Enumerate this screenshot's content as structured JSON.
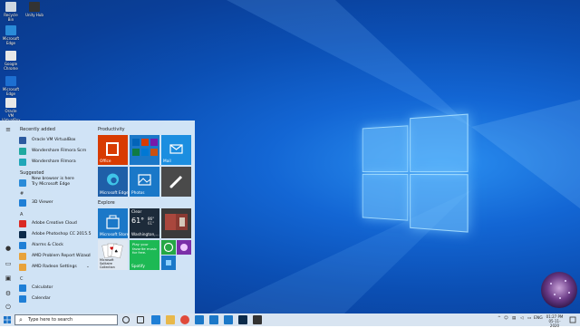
{
  "desktop_icons": [
    {
      "label": "Recycle Bin",
      "color": "#cfd8e2"
    },
    {
      "label": "Microsoft Edge",
      "color": "#2a8bd8"
    },
    {
      "label": "Google Chrome",
      "color": "#e8e8e8"
    },
    {
      "label": "Microsoft Edge",
      "color": "#1d6fd1"
    },
    {
      "label": "Oracle VM VirtualBox",
      "color": "#e8e8e8"
    },
    {
      "label": "Unity Hub",
      "color": "#333333"
    }
  ],
  "start_menu": {
    "recently_added_header": "Recently added",
    "recent": [
      {
        "label": "Oracle VM VirtualBox",
        "icon": "virtualbox-icon",
        "color": "#2c5aa0"
      },
      {
        "label": "Wondershare Filmora Scrn",
        "icon": "filmora-scrn-icon",
        "color": "#1fa9a0"
      },
      {
        "label": "Wondershare Filmora",
        "icon": "filmora-icon",
        "color": "#20a7b8"
      }
    ],
    "suggested_header": "Suggested",
    "suggested": {
      "line1": "New browser is here",
      "line2": "Try Microsoft Edge",
      "icon": "edge-icon",
      "color": "#2a8bd8"
    },
    "groups": [
      {
        "letter": "#",
        "items": [
          {
            "label": "3D Viewer",
            "icon": "3d-viewer-icon",
            "color": "#1f7fd6",
            "chevron": false
          }
        ]
      },
      {
        "letter": "A",
        "items": [
          {
            "label": "Adobe Creative Cloud",
            "icon": "creative-cloud-icon",
            "color": "#da2a24",
            "chevron": false
          },
          {
            "label": "Adobe Photoshop CC 2015.5",
            "icon": "photoshop-icon",
            "color": "#0b2a4a",
            "chevron": false
          },
          {
            "label": "Alarms & Clock",
            "icon": "alarm-clock-icon",
            "color": "#1f7fd6",
            "chevron": false
          },
          {
            "label": "AMD Problem Report Wizard",
            "icon": "amd-icon",
            "color": "#e8a23a",
            "chevron": true
          },
          {
            "label": "AMD Radeon Settings",
            "icon": "amd-radeon-icon",
            "color": "#e8a23a",
            "chevron": true
          }
        ]
      },
      {
        "letter": "C",
        "items": [
          {
            "label": "Calculator",
            "icon": "calculator-icon",
            "color": "#1f7fd6",
            "chevron": false
          },
          {
            "label": "Calendar",
            "icon": "calendar-icon",
            "color": "#1f7fd6",
            "chevron": false
          }
        ]
      }
    ],
    "productivity_header": "Productivity",
    "explore_header": "Explore",
    "tiles": {
      "office": {
        "label": "Office",
        "color": "#d83b01"
      },
      "mini_apps": {
        "color": "#1b78c8",
        "apps": [
          "#0364b8",
          "#d83b01",
          "#7719aa",
          "#0f7b45",
          "#0078d4",
          "#ca5010"
        ]
      },
      "mail": {
        "label": "Mail",
        "color": "#1b8ee0"
      },
      "edge": {
        "label": "Microsoft Edge",
        "color": "#1f5fa8"
      },
      "photos": {
        "label": "Photos",
        "color": "#1a78c8"
      },
      "pen": {
        "color": "#4a4a4a"
      },
      "store": {
        "label": "Microsoft Store",
        "color": "#1b78c8"
      },
      "weather": {
        "label": "Clear",
        "temp": "61°",
        "high": "86°",
        "low": "61°",
        "city": "Washington,...",
        "color": "#1d2b3a"
      },
      "news": {
        "color": "#3a3a3a"
      },
      "solitaire": {
        "label": "Microsoft Solitaire Collection",
        "color": "#dfe8f2"
      },
      "spotify": {
        "label": "Spotify",
        "line1": "Play your",
        "line2": "favorite music",
        "line3": "for free.",
        "color": "#1db954"
      },
      "whatsapp": {
        "color": "#25a744"
      },
      "play": {
        "color": "#7b2fa8"
      }
    }
  },
  "taskbar": {
    "search_placeholder": "Type here to search",
    "apps": [
      "cortana-icon",
      "task-view-icon",
      "edge-icon",
      "file-explorer-icon",
      "chrome-icon",
      "store-icon",
      "mail-icon",
      "photos-icon",
      "photoshop-icon",
      "terminal-icon"
    ],
    "tray_up": "^",
    "language": "ENG",
    "time": "01:27 PM",
    "date": "05-11-2020"
  }
}
